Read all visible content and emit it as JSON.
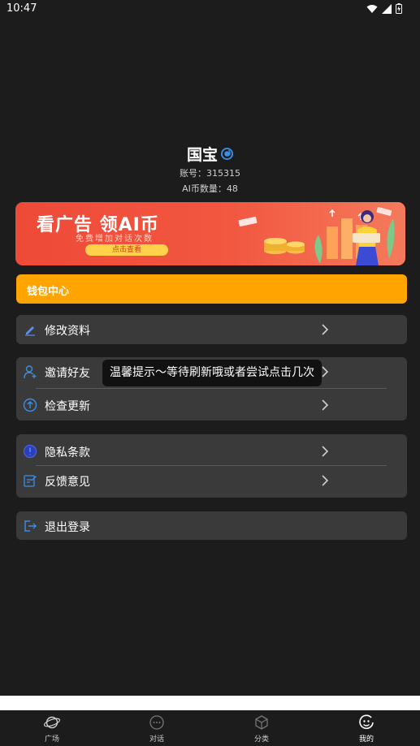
{
  "status_bar": {
    "time": "10:47"
  },
  "profile": {
    "name": "国宝",
    "account_label": "账号：",
    "account_value": "315315",
    "coins_label": "AI币数量：",
    "coins_value": "48"
  },
  "banner": {
    "title": "看广告 领AI币",
    "subtitle": "免费增加对话次数",
    "button_label": "点击查看"
  },
  "wallet": {
    "title": "钱包中心"
  },
  "menu": {
    "edit_profile": "修改资料",
    "invite_friends": "邀请好友",
    "check_update": "检查更新",
    "privacy": "隐私条款",
    "feedback": "反馈意见",
    "logout": "退出登录"
  },
  "toast": {
    "text": "温馨提示～等待刷新哦或者尝试点击几次"
  },
  "tabs": [
    {
      "label": "广场",
      "icon": "planet-icon"
    },
    {
      "label": "对话",
      "icon": "chat-bubble-icon"
    },
    {
      "label": "分类",
      "icon": "cube-icon"
    },
    {
      "label": "我的",
      "icon": "smiley-face-icon",
      "active": true
    }
  ],
  "colors": {
    "background": "#1c1c1c",
    "card": "#3a3a3a",
    "wallet": "#ffa400",
    "banner": "#ee4a38",
    "accent_blue": "#3a8ee6"
  }
}
